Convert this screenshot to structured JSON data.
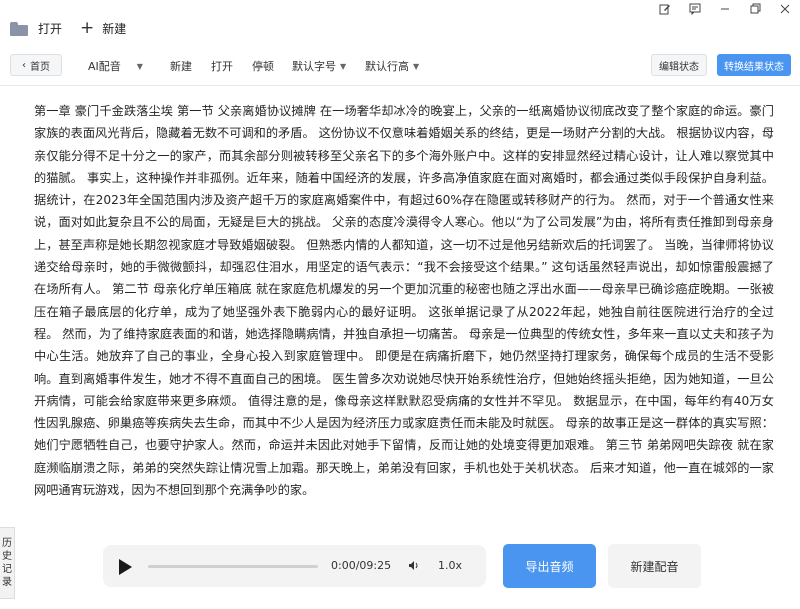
{
  "titlebar": {
    "open_label": "打开",
    "new_label": "新建",
    "window_controls": [
      "edit-icon",
      "feedback-icon",
      "minimize-icon",
      "restore-icon",
      "close-icon"
    ]
  },
  "toolbar": {
    "home_label": "首页",
    "ai_dub_label": "AI配音",
    "new_label": "新建",
    "open_label": "打开",
    "pause_label": "停顿",
    "font_size_label": "默认字号",
    "line_height_label": "默认行高",
    "edit_state_label": "编辑状态",
    "result_state_label": "转换结果状态"
  },
  "content": {
    "text": "第一章 豪门千金跌落尘埃 第一节 父亲离婚协议摊牌 在一场奢华却冰冷的晚宴上，父亲的一纸离婚协议彻底改变了整个家庭的命运。豪门家族的表面风光背后，隐藏着无数不可调和的矛盾。 这份协议不仅意味着婚姻关系的终结，更是一场财产分割的大战。 根据协议内容，母亲仅能分得不足十分之一的家产，而其余部分则被转移至父亲名下的多个海外账户中。这样的安排显然经过精心设计，让人难以察觉其中的猫腻。 事实上，这种操作并非孤例。近年来，随着中国经济的发展，许多高净值家庭在面对离婚时，都会通过类似手段保护自身利益。 据统计，在2023年全国范围内涉及资产超千万的家庭离婚案件中，有超过60%存在隐匿或转移财产的行为。 然而，对于一个普通女性来说，面对如此复杂且不公的局面，无疑是巨大的挑战。 父亲的态度冷漠得令人寒心。他以“为了公司发展”为由，将所有责任推卸到母亲身上，甚至声称是她长期忽视家庭才导致婚姻破裂。 但熟悉内情的人都知道，这一切不过是他另结新欢后的托词罢了。 当晚，当律师将协议递交给母亲时，她的手微微颤抖，却强忍住泪水，用坚定的语气表示：“我不会接受这个结果。” 这句话虽然轻声说出，却如惊雷般震撼了在场所有人。 第二节 母亲化疗单压箱底 就在家庭危机爆发的另一个更加沉重的秘密也随之浮出水面——母亲早已确诊癌症晚期。一张被压在箱子最底层的化疗单，成为了她坚强外表下脆弱内心的最好证明。 这张单据记录了从2022年起，她独自前往医院进行治疗的全过程。 然而，为了维持家庭表面的和谐，她选择隐瞒病情，并独自承担一切痛苦。 母亲是一位典型的传统女性，多年来一直以丈夫和孩子为中心生活。她放弃了自己的事业，全身心投入到家庭管理中。 即便是在病痛折磨下，她仍然坚持打理家务，确保每个成员的生活不受影响。直到离婚事件发生，她才不得不直面自己的困境。 医生曾多次劝说她尽快开始系统性治疗，但她始终摇头拒绝，因为她知道，一旦公开病情，可能会给家庭带来更多麻烦。 值得注意的是，像母亲这样默默忍受病痛的女性并不罕见。 数据显示，在中国，每年约有40万女性因乳腺癌、卵巢癌等疾病失去生命，而其中不少人是因为经济压力或家庭责任而未能及时就医。 母亲的故事正是这一群体的真实写照：她们宁愿牺牲自己，也要守护家人。然而，命运并未因此对她手下留情，反而让她的处境变得更加艰难。 第三节 弟弟网吧失踪夜 就在家庭濒临崩溃之际，弟弟的突然失踪让情况雪上加霜。那天晚上，弟弟没有回家，手机也处于关机状态。 后来才知道，他一直在城郊的一家网吧通宵玩游戏，因为不想回到那个充满争吵的家。"
  },
  "sidebar": {
    "history_label": "历史记录"
  },
  "player": {
    "time_label": "0:00/09:25",
    "speed_label": "1.0x",
    "progress": 0
  },
  "actions": {
    "export_label": "导出音频",
    "new_dub_label": "新建配音"
  }
}
